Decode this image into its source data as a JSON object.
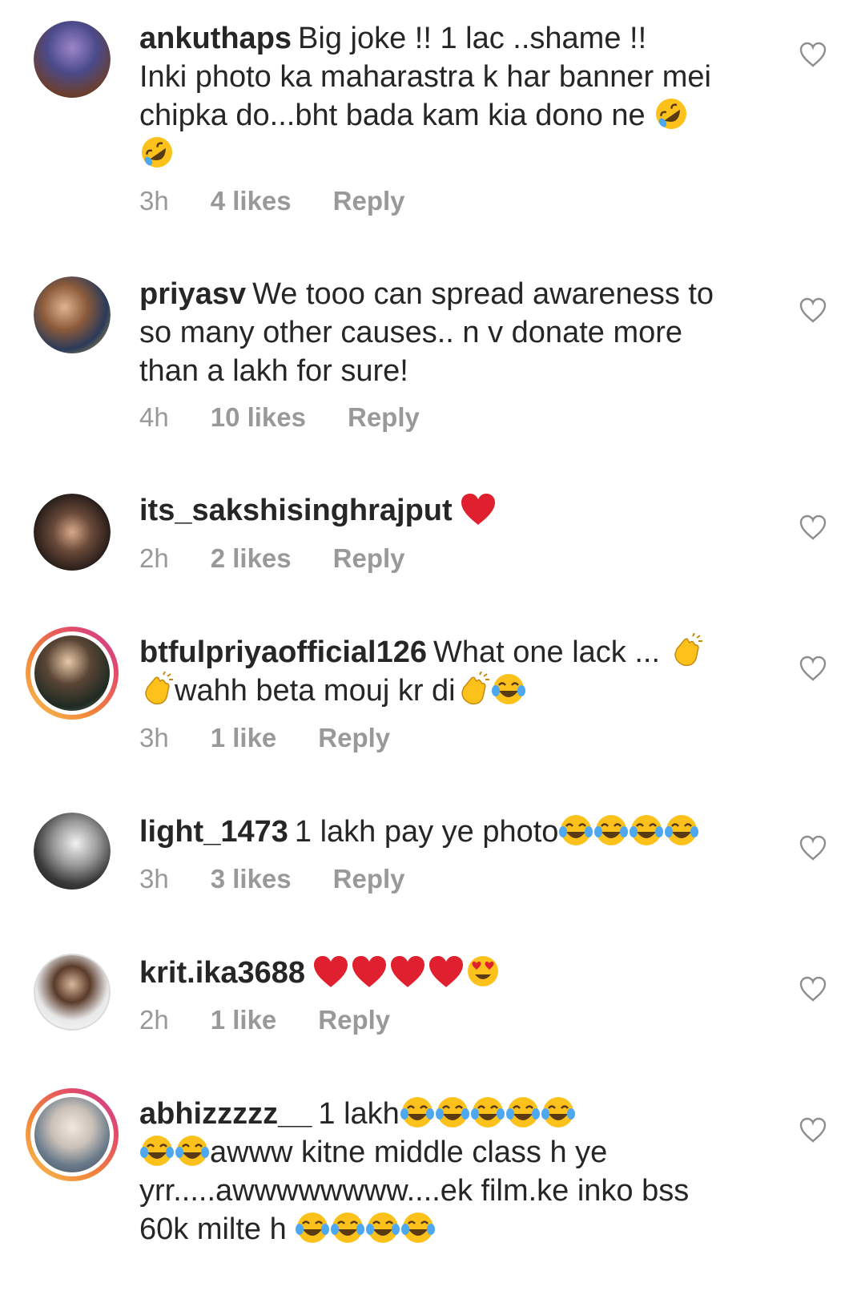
{
  "comments": [
    {
      "username": "ankuthaps",
      "text": "Big joke !! 1 lac ..shame !!",
      "text2": "Inki photo ka maharastra k har banner mei",
      "text3": "chipka do...bht bada kam kia dono ne",
      "time": "3h",
      "likes": "4 likes",
      "reply": "Reply",
      "story_ring": false
    },
    {
      "username": "priyasv",
      "text": "We tooo can spread awareness to",
      "text2": "so many other causes.. n v donate more",
      "text3": "than a lakh for sure!",
      "time": "4h",
      "likes": "10 likes",
      "reply": "Reply",
      "story_ring": false
    },
    {
      "username": "its_sakshisinghrajput",
      "text": "",
      "time": "2h",
      "likes": "2 likes",
      "reply": "Reply",
      "story_ring": false
    },
    {
      "username": "btfulpriyaofficial126",
      "text": "What one lack ...",
      "text2": "wahh beta mouj kr di",
      "time": "3h",
      "likes": "1 like",
      "reply": "Reply",
      "story_ring": true
    },
    {
      "username": "light_1473",
      "text": "1 lakh pay ye photo",
      "time": "3h",
      "likes": "3 likes",
      "reply": "Reply",
      "story_ring": false
    },
    {
      "username": "krit.ika3688",
      "text": "",
      "time": "2h",
      "likes": "1 like",
      "reply": "Reply",
      "story_ring": false
    },
    {
      "username": "abhizzzzz__",
      "text": "1 lakh",
      "text2": "awww kitne middle class h ye",
      "text3": "yrr.....awwwwwwww....ek film.ke inko bss",
      "text4": "60k milte h",
      "story_ring": true
    }
  ],
  "icons": {
    "like": "heart-outline-icon",
    "rofl": "rolling-on-floor-laughing-emoji",
    "tears": "tears-of-joy-emoji",
    "clap": "clapping-hands-emoji",
    "red_heart": "red-heart-emoji",
    "heart_eyes": "heart-eyes-emoji"
  },
  "colors": {
    "text": "#262626",
    "meta": "#999999",
    "heart_red": "#e0202e",
    "story_ring": "#e24a6b"
  }
}
